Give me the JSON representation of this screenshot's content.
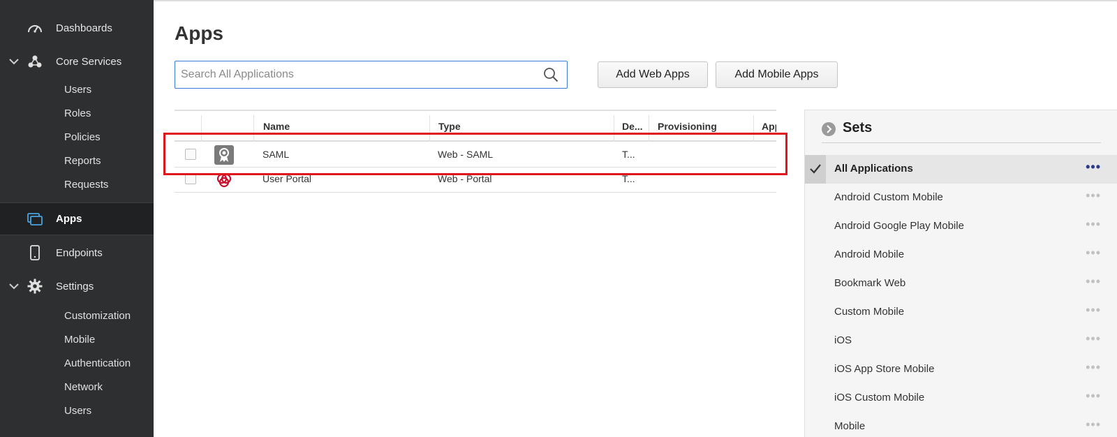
{
  "sidebar": {
    "items": [
      {
        "label": "Dashboards",
        "icon": "gauge-icon"
      },
      {
        "label": "Core Services",
        "icon": "cluster-icon"
      },
      {
        "label": "Apps",
        "icon": "apps-icon"
      },
      {
        "label": "Endpoints",
        "icon": "phone-icon"
      },
      {
        "label": "Settings",
        "icon": "gear-icon"
      }
    ],
    "core_services_sub": [
      "Users",
      "Roles",
      "Policies",
      "Reports",
      "Requests"
    ],
    "settings_sub": [
      "Customization",
      "Mobile",
      "Authentication",
      "Network",
      "Users"
    ]
  },
  "main": {
    "title": "Apps",
    "search_placeholder": "Search All Applications",
    "add_web_apps": "Add Web Apps",
    "add_mobile_apps": "Add Mobile Apps"
  },
  "table": {
    "headers": [
      "Name",
      "Type",
      "De...",
      "Provisioning",
      "App"
    ],
    "rows": [
      {
        "name": "SAML",
        "type": "Web - SAML",
        "desc": "T...",
        "icon": "certificate-icon"
      },
      {
        "name": "User Portal",
        "type": "Web - Portal",
        "desc": "T...",
        "icon": "portal-logo-icon"
      }
    ]
  },
  "sets": {
    "title": "Sets",
    "items": [
      "All Applications",
      "Android Custom Mobile",
      "Android Google Play Mobile",
      "Android Mobile",
      "Bookmark Web",
      "Custom Mobile",
      "iOS",
      "iOS App Store Mobile",
      "iOS Custom Mobile",
      "Mobile"
    ],
    "active_index": 0,
    "more_glyph": "•••"
  },
  "colors": {
    "sidebar_bg": "#2d2f31",
    "accent_blue": "#3a7bd5",
    "highlight_red": "#e0161e",
    "apps_icon": "#4aa3df"
  }
}
